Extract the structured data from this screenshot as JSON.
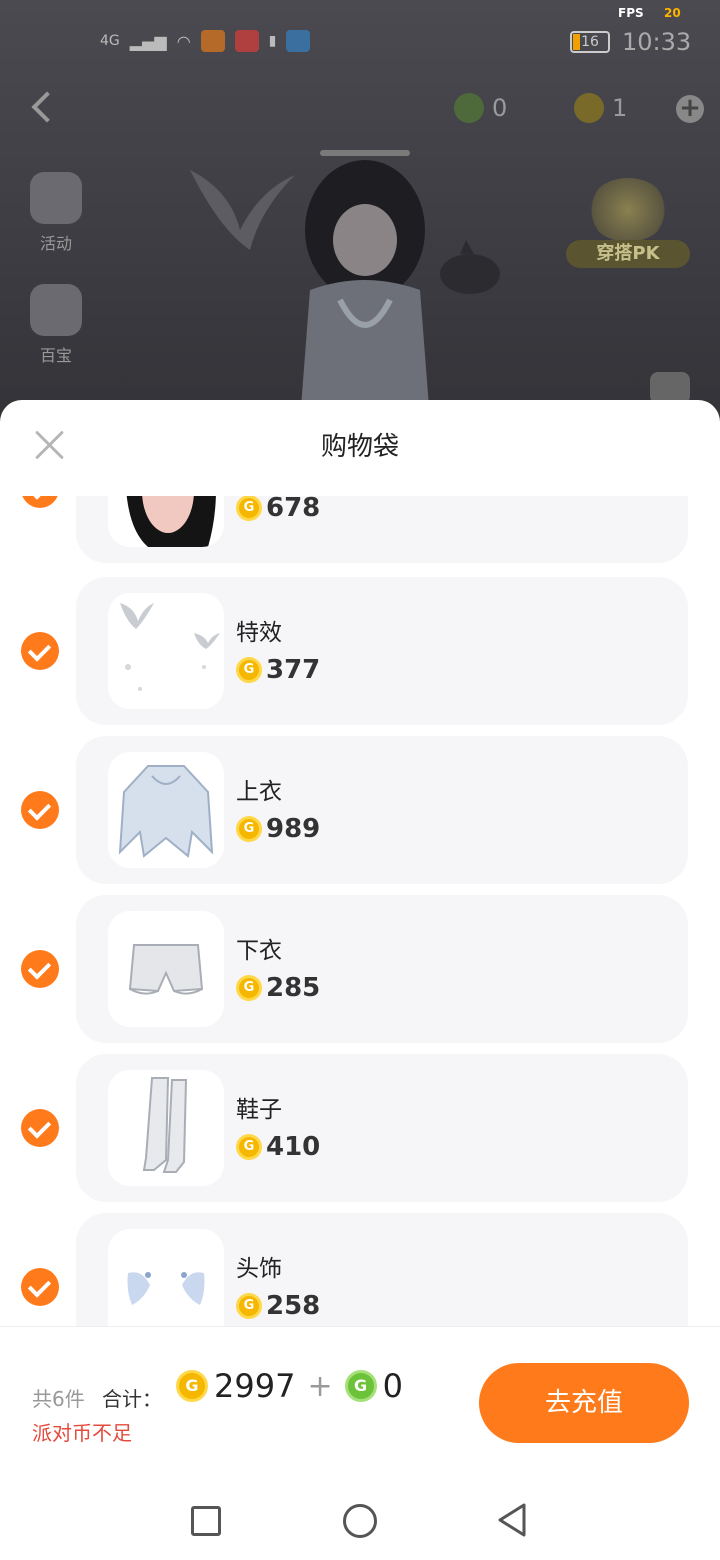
{
  "status_bar": {
    "fps_label": "FPS",
    "fps_value": "20",
    "network": "4G",
    "battery": "16",
    "time": "10:33"
  },
  "top_bar": {
    "green_coin_balance": "0",
    "gold_coin_balance": "1"
  },
  "side_menu": {
    "activity_label": "活动",
    "second_label": "百宝"
  },
  "pk_badge": {
    "label": "穿搭PK"
  },
  "sheet": {
    "title": "购物袋",
    "items": [
      {
        "name": "",
        "price": "678",
        "icon": "hair"
      },
      {
        "name": "特效",
        "price": "377",
        "icon": "doves-effect"
      },
      {
        "name": "上衣",
        "price": "989",
        "icon": "top-dress"
      },
      {
        "name": "下衣",
        "price": "285",
        "icon": "bloomers"
      },
      {
        "name": "鞋子",
        "price": "410",
        "icon": "boots"
      },
      {
        "name": "头饰",
        "price": "258",
        "icon": "headwear"
      }
    ]
  },
  "footer": {
    "count_text": "共6件",
    "total_label": "合计：",
    "gold_total": "2997",
    "plus": "+",
    "green_total": "0",
    "warning": "派对币不足",
    "recharge_button": "去充值"
  },
  "colors": {
    "accent": "#ff7a1a",
    "warning": "#e54a3c",
    "gold_coin": "#f5b700",
    "green_coin": "#6cc33a"
  }
}
